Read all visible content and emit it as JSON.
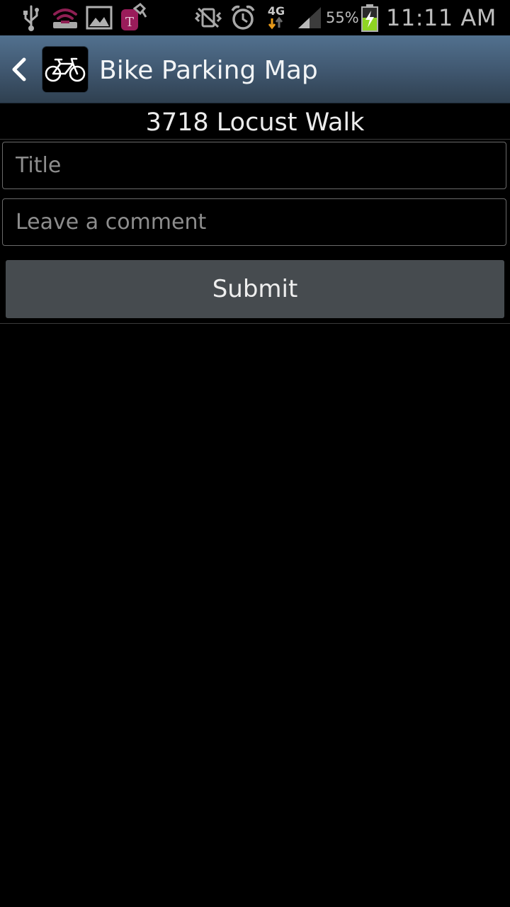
{
  "status_bar": {
    "icons": [
      "usb-icon",
      "wifi-hotspot-icon",
      "gallery-icon",
      "tmobile-icon",
      "vibrate-icon",
      "alarm-icon",
      "4g-data-icon",
      "signal-icon",
      "battery-charging-icon"
    ],
    "network": "4G",
    "battery": "55%",
    "time": "11:11 AM"
  },
  "action_bar": {
    "title": "Bike Parking Map",
    "logo_icon": "bicycle-icon",
    "back_icon": "back-arrow-icon"
  },
  "location": {
    "address": "3718 Locust Walk"
  },
  "form": {
    "title_placeholder": "Title",
    "title_value": "",
    "comment_placeholder": "Leave a comment",
    "comment_value": "",
    "submit_label": "Submit"
  },
  "colors": {
    "action_bar_top": "#52718f",
    "action_bar_bottom": "#2f4050",
    "button_bg": "#464b4f",
    "battery_green": "#8fd422",
    "tmobile_magenta": "#9a1c5a"
  }
}
